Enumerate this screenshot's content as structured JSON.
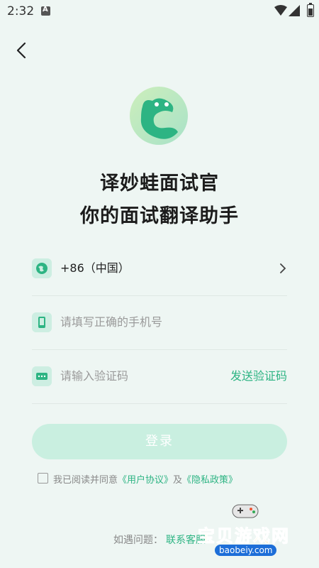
{
  "status_bar": {
    "time": "2:32"
  },
  "colors": {
    "accent": "#2db483",
    "login_disabled": "#c9efe0",
    "background": "#eef6f3"
  },
  "app": {
    "name": "译妙蛙面试官",
    "slogan": "你的面试翻译助手"
  },
  "form": {
    "country": {
      "value": "+86（中国）",
      "icon": "globe-icon"
    },
    "phone": {
      "placeholder": "请填写正确的手机号",
      "icon": "phone-icon"
    },
    "code": {
      "placeholder": "请输入验证码",
      "icon": "sms-icon",
      "send_label": "发送验证码"
    },
    "login_label": "登录"
  },
  "agreement": {
    "prefix": "我已阅读并同意",
    "user_agreement": "《用户协议》",
    "and": "及",
    "privacy_policy": "《隐私政策》",
    "checked": false
  },
  "help": {
    "prefix": "如遇问题：",
    "contact_label": "联系客服"
  },
  "watermark": {
    "title": "宝贝游戏网",
    "url": "baobeiy.com"
  }
}
